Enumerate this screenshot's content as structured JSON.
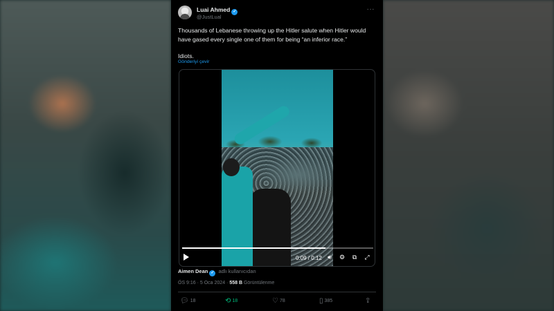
{
  "tweet": {
    "author_name": "Luai Ahmed",
    "author_handle": "@JustLual",
    "more_icon": "more-icon",
    "text_line1": "Thousands of Lebanese throwing up the Hitler salute when Hitler would have gased every single one of them for being “an inferior race.”",
    "text_line2": "Idiots.",
    "translate_label": "Gönderiyi çevir"
  },
  "video": {
    "time_display": "0:09 / 0:12",
    "progress": 0.75,
    "controls": [
      "play-icon",
      "volume-icon",
      "settings-icon",
      "minimize-icon",
      "fullscreen-icon"
    ]
  },
  "source": {
    "name": "Aimen Dean",
    "suffix": "adlı kullanıcıdan"
  },
  "meta": {
    "time_date": "ÖS 9:16 · 5 Oca 2024 ·",
    "views_count": "558 B",
    "views_label": "Görüntülenme"
  },
  "actions": {
    "replies": "18",
    "retweets": "18",
    "likes": "78",
    "bookmarks": "385"
  },
  "colors": {
    "accent": "#1d9bf0",
    "retweet": "#00ba7c",
    "muted": "#71767b",
    "background": "#000000"
  }
}
